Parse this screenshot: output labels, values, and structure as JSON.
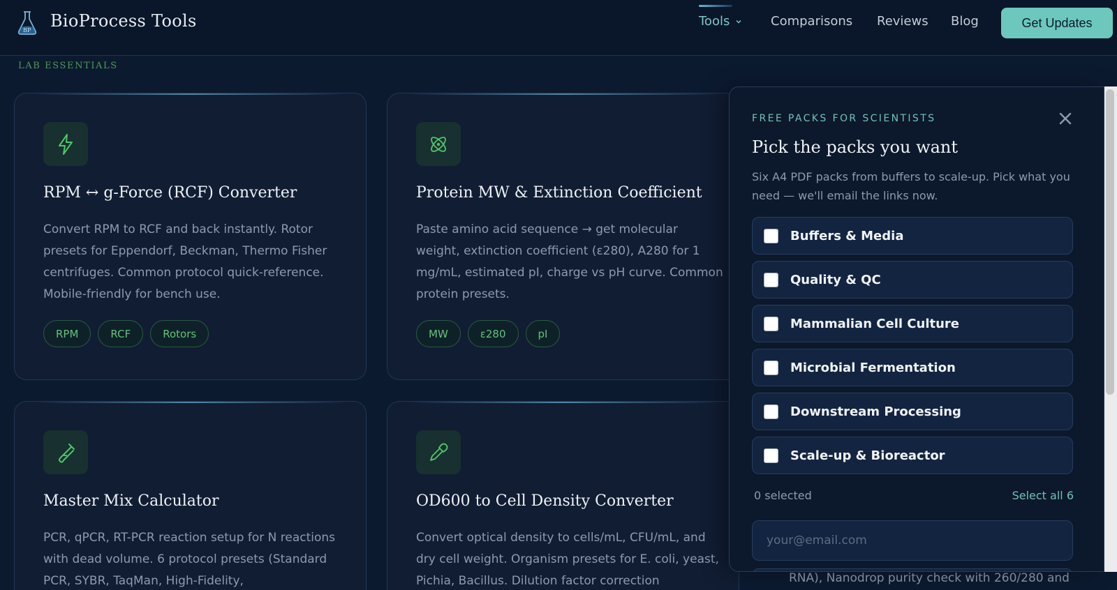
{
  "header": {
    "brand": "BioProcess Tools",
    "logo_text": "BP",
    "nav": {
      "tools": "Tools",
      "comparisons": "Comparisons",
      "reviews": "Reviews",
      "blog": "Blog"
    },
    "cta": "Get Updates"
  },
  "section": {
    "eyebrow": "LAB ESSENTIALS"
  },
  "cards": [
    {
      "icon": "lightning-icon",
      "title": "RPM ↔ g-Force (RCF) Converter",
      "desc": "Convert RPM to RCF and back instantly. Rotor presets for Eppendorf, Beckman, Thermo Fisher centrifuges. Common protocol quick-reference. Mobile-friendly for bench use.",
      "tags": [
        "RPM",
        "RCF",
        "Rotors"
      ]
    },
    {
      "icon": "atom-icon",
      "title": "Protein MW & Extinction Coefficient",
      "desc": "Paste amino acid sequence → get molecular weight, extinction coefficient (ε280), A280 for 1 mg/mL, estimated pI, charge vs pH curve. Common protein presets.",
      "tags": [
        "MW",
        "ε280",
        "pI"
      ]
    },
    {
      "icon": "test-tube-icon",
      "title": "Master Mix Calculator",
      "desc": "PCR, qPCR, RT-PCR reaction setup for N reactions with dead volume. 6 protocol presets (Standard PCR, SYBR, TaqMan, High-Fidelity,"
    },
    {
      "icon": "pipette-icon",
      "title": "OD600 to Cell Density Converter",
      "desc": "Convert optical density to cells/mL, CFU/mL, and dry cell weight. Organism presets for E. coli, yeast, Pichia, Bacillus. Dilution factor correction"
    }
  ],
  "background_peek": "RNA), Nanodrop purity check with 260/280 and",
  "panel": {
    "eyebrow": "FREE PACKS FOR SCIENTISTS",
    "title": "Pick the packs you want",
    "subtitle": "Six A4 PDF packs from buffers to scale-up. Pick what you need — we'll email the links now.",
    "packs": [
      {
        "label": "Buffers & Media",
        "checked": false
      },
      {
        "label": "Quality & QC",
        "checked": false
      },
      {
        "label": "Mammalian Cell Culture",
        "checked": false
      },
      {
        "label": "Microbial Fermentation",
        "checked": false
      },
      {
        "label": "Downstream Processing",
        "checked": false
      },
      {
        "label": "Scale-up & Bioreactor",
        "checked": false
      }
    ],
    "selected_count": "0 selected",
    "select_all": "Select all 6",
    "email_placeholder": "your@email.com",
    "email_value": ""
  },
  "colors": {
    "background": "#0c1a30",
    "accent_teal": "#6cc8bd",
    "tag_green": "#62c27b",
    "eyebrow_green": "#4f9a55"
  }
}
